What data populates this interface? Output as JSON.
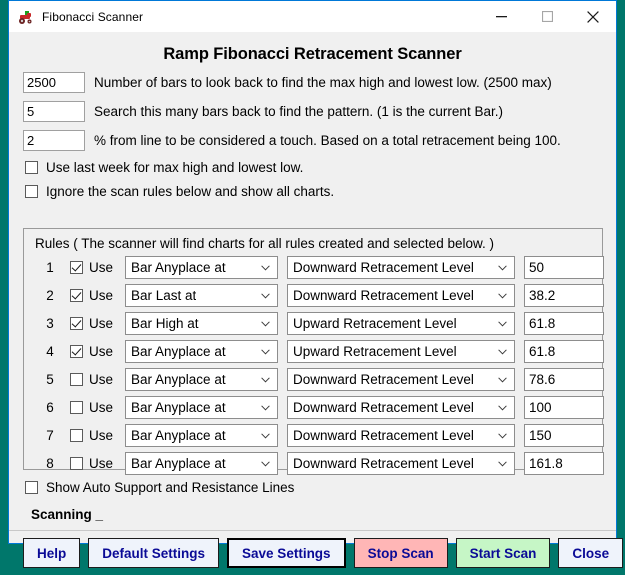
{
  "window": {
    "title": "Fibonacci Scanner",
    "icon": "tractor-icon",
    "controls": {
      "minimize": "minimize-icon",
      "maximize": "maximize-icon",
      "close": "close-icon"
    }
  },
  "page_title": "Ramp Fibonacci Retracement Scanner",
  "params": [
    {
      "value": "2500",
      "label": "Number of bars to look back to find the max high and lowest low. (2500 max)"
    },
    {
      "value": "5",
      "label": "Search this many bars back to find the pattern. (1 is the current Bar.)"
    },
    {
      "value": "2",
      "label": "% from line to be considered a touch.  Based on a total retracement being 100."
    }
  ],
  "options": [
    {
      "label": "Use last week for max high and lowest low.",
      "checked": false
    },
    {
      "label": "Ignore the scan rules below and show all charts.",
      "checked": false
    }
  ],
  "rules": {
    "caption": "Rules  ( The scanner will find charts for all rules created and selected below. )",
    "use_label": "Use",
    "rows": [
      {
        "num": "1",
        "checked": true,
        "type": "Bar Anyplace at",
        "level": "Downward Retracement Level",
        "value": "50"
      },
      {
        "num": "2",
        "checked": true,
        "type": "Bar Last at",
        "level": "Downward Retracement Level",
        "value": "38.2"
      },
      {
        "num": "3",
        "checked": true,
        "type": "Bar High at",
        "level": "Upward Retracement Level",
        "value": "61.8"
      },
      {
        "num": "4",
        "checked": true,
        "type": "Bar Anyplace at",
        "level": "Upward Retracement Level",
        "value": "61.8"
      },
      {
        "num": "5",
        "checked": false,
        "type": "Bar Anyplace at",
        "level": "Downward Retracement Level",
        "value": "78.6"
      },
      {
        "num": "6",
        "checked": false,
        "type": "Bar Anyplace at",
        "level": "Downward Retracement Level",
        "value": "100"
      },
      {
        "num": "7",
        "checked": false,
        "type": "Bar Anyplace at",
        "level": "Downward Retracement Level",
        "value": "150"
      },
      {
        "num": "8",
        "checked": false,
        "type": "Bar Anyplace at",
        "level": "Downward Retracement Level",
        "value": "161.8"
      }
    ]
  },
  "auto_lines": {
    "label": "Show Auto Support and Resistance Lines",
    "checked": false
  },
  "status": "Scanning _",
  "buttons": [
    {
      "label": "Help",
      "style": "plain",
      "focused": false
    },
    {
      "label": "Default Settings",
      "style": "plain",
      "focused": false
    },
    {
      "label": "Save Settings",
      "style": "plain",
      "focused": true
    },
    {
      "label": "Stop Scan",
      "style": "stop",
      "focused": false
    },
    {
      "label": "Start Scan",
      "style": "start",
      "focused": false
    },
    {
      "label": "Close",
      "style": "plain",
      "focused": false
    }
  ],
  "colors": {
    "desktop": "#00776b",
    "window_border": "#0078d7",
    "client_bg": "#f0f0f0",
    "button_text": "#0a0a96",
    "stop_bg": "#ffb6b6",
    "start_bg": "#c6f6c6"
  }
}
